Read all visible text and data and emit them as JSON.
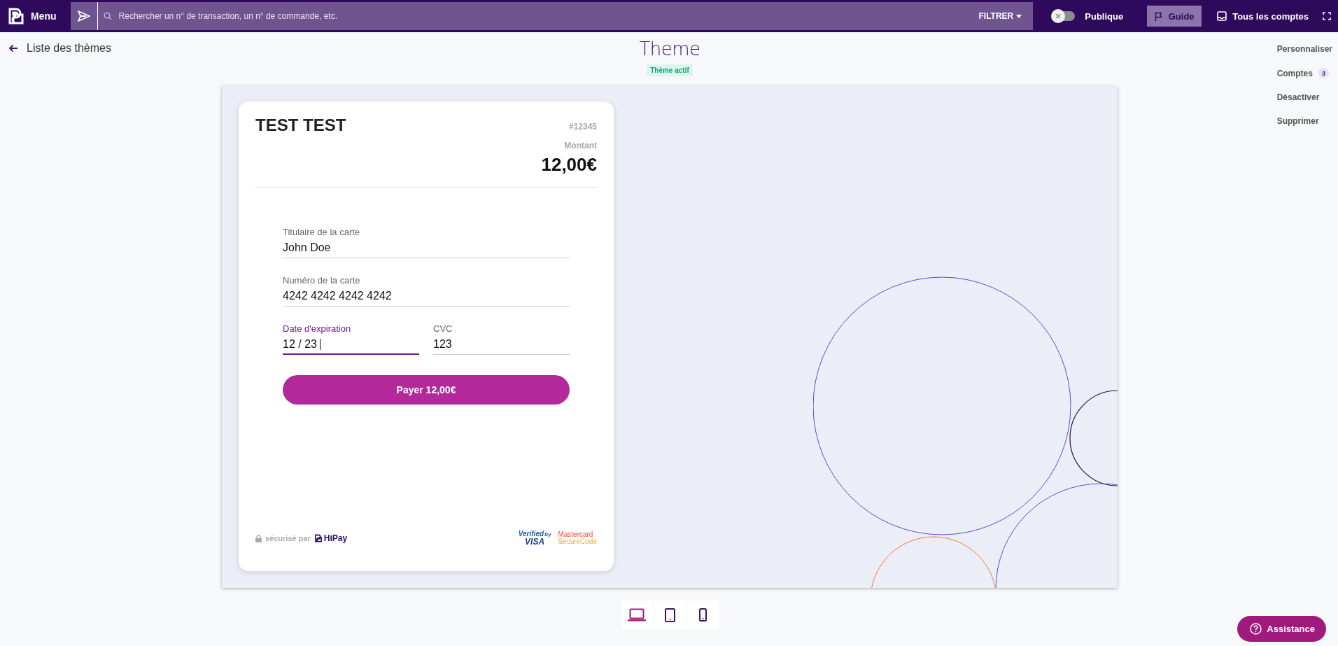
{
  "topbar": {
    "menu_label": "Menu",
    "search_placeholder": "Rechercher un n° de transaction, un n° de commande, etc.",
    "filter_label": "FILTRER",
    "visibility_toggle": {
      "label": "Publique",
      "on": false
    },
    "guide_label": "Guide",
    "accounts_label": "Tous les comptes"
  },
  "header": {
    "back_label": "Liste des thèmes",
    "title": "Theme",
    "status_badge": "Thème actif"
  },
  "side_menu": [
    {
      "label": "Personnaliser"
    },
    {
      "label": "Comptes",
      "count": "3"
    },
    {
      "label": "Désactiver"
    },
    {
      "label": "Supprimer"
    }
  ],
  "preview": {
    "card": {
      "holder_title": "TEST TEST",
      "order_number": "#12345",
      "amount_label": "Montant",
      "amount": "12,00€",
      "field_rows": [
        {
          "fields": [
            {
              "label": "Titulaire de la carte",
              "value": "John Doe",
              "focused": false
            }
          ]
        },
        {
          "fields": [
            {
              "label": "Numéro de la carte",
              "value": "4242 4242 4242 4242",
              "focused": false
            }
          ]
        },
        {
          "fields": [
            {
              "label": "Date d'expiration",
              "value": "12 / 23",
              "focused": true
            },
            {
              "label": "CVC",
              "value": "123",
              "focused": false
            }
          ]
        }
      ],
      "pay_button": "Payer 12,00€",
      "secured_text": "sécurisé par",
      "brand": "HiPay",
      "verified_text": "Verified",
      "verified_by": "by",
      "visa_text": "VISA",
      "mastercard_text": "Mastercard",
      "securecode_text": "SecureCode"
    }
  },
  "devices": [
    {
      "kind": "laptop",
      "selected": true
    },
    {
      "kind": "tablet",
      "selected": false
    },
    {
      "kind": "phone",
      "selected": false
    }
  ],
  "assistance_label": "Assistance"
}
